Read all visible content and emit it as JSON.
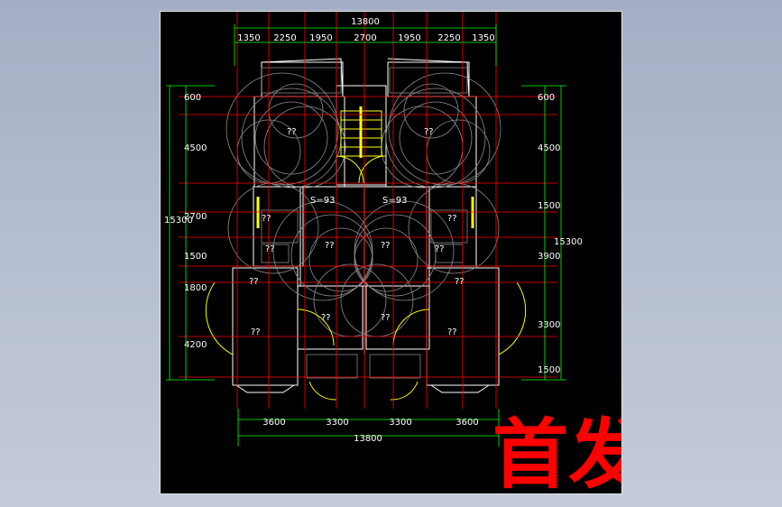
{
  "drawing": {
    "top_dims": {
      "overall": "13800",
      "segments": [
        "1350",
        "2250",
        "1950",
        "2700",
        "1950",
        "2250",
        "1350"
      ]
    },
    "bottom_dims": {
      "segments": [
        "3600",
        "3300",
        "3300",
        "3600"
      ],
      "overall": "13800"
    },
    "left_dims": {
      "overall": "15300",
      "segments": [
        "600",
        "4500",
        "2700",
        "1500",
        "1800",
        "4200"
      ]
    },
    "right_dims": {
      "overall": "15300",
      "segments": [
        "600",
        "4500",
        "1500",
        "3900",
        "3300",
        "1500"
      ]
    },
    "room_labels": {
      "area_left": "S=93",
      "area_right": "S=93",
      "unknown": "??"
    },
    "watermark": "首发"
  }
}
